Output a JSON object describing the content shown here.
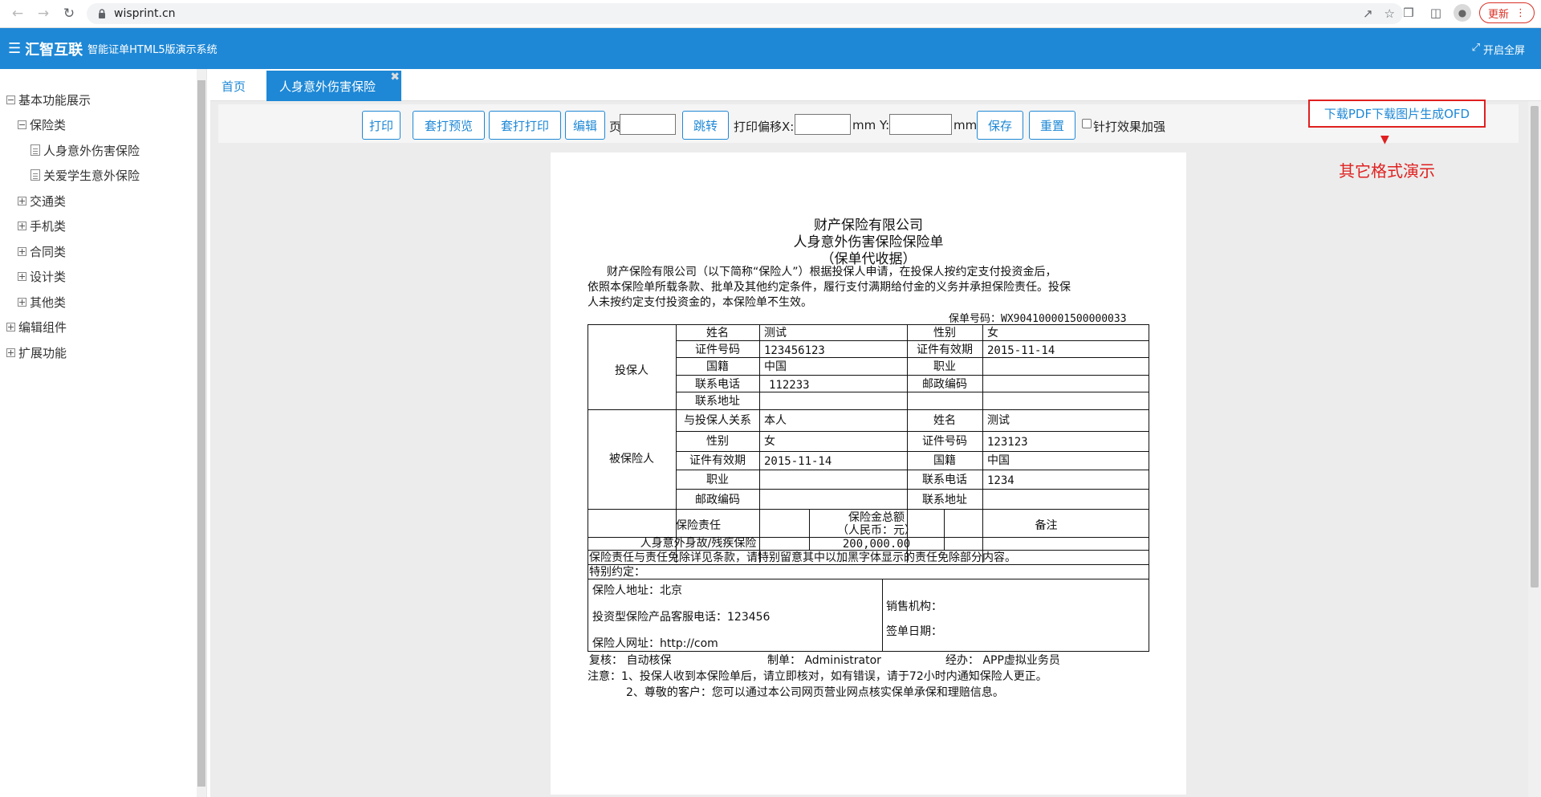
{
  "browser": {
    "url": "wisprint.cn",
    "update_label": "更新"
  },
  "header": {
    "brand": "汇智互联",
    "subtitle": "智能证单HTML5版演示系统",
    "fullscreen_label": "开启全屏"
  },
  "sidebar": {
    "items": [
      {
        "label": "基本功能展示"
      },
      {
        "label": "保险类"
      },
      {
        "label": "人身意外伤害保险"
      },
      {
        "label": "关爱学生意外保险"
      },
      {
        "label": "交通类"
      },
      {
        "label": "手机类"
      },
      {
        "label": "合同类"
      },
      {
        "label": "设计类"
      },
      {
        "label": "其他类"
      },
      {
        "label": "编辑组件"
      },
      {
        "label": "扩展功能"
      }
    ]
  },
  "tabs": {
    "home": "首页",
    "active": "人身意外伤害保险",
    "close": "✖"
  },
  "toolbar": {
    "print": "打印",
    "overlay_preview": "套打预览",
    "overlay_print": "套打打印",
    "edit": "编辑",
    "page_label": "页",
    "page_value": "",
    "jump": "跳转",
    "offset_x_label": "打印偏移X:",
    "offset_x_value": "",
    "mm_y_label": "mm Y:",
    "offset_y_value": "",
    "mm_label": "mm",
    "save": "保存",
    "reset": "重置",
    "needle_label": "针打效果加强"
  },
  "extra": {
    "box_text": "下载PDF下载图片生成OFD",
    "caption": "其它格式演示"
  },
  "document": {
    "company": "财产保险有限公司",
    "title": "人身意外伤害保险保险单",
    "subtitle": "（保单代收据）",
    "intro_1": "财产保险有限公司（以下简称“保险人”）根据投保人申请，在投保人按约定支付投资金后，",
    "intro_2": "依照本保险单所载条款、批单及其他约定条件，履行支付满期给付金的义务并承担保险责任。投保",
    "intro_3": "人未按约定支付投资金的，本保险单不生效。",
    "policy_no": "保单号码：WX904100001500000033",
    "applicant": {
      "section": "投保人",
      "name_label": "姓名",
      "name": "测试",
      "gender_label": "性别",
      "gender": "女",
      "id_label": "证件号码",
      "id": "123456123",
      "id_valid_label": "证件有效期",
      "id_valid": "2015-11-14",
      "nationality_label": "国籍",
      "nationality": "中国",
      "job_label": "职业",
      "job": "",
      "phone_label": "联系电话",
      "phone": "112233",
      "zip_label": "邮政编码",
      "zip": "",
      "address_label": "联系地址",
      "address": ""
    },
    "insured": {
      "section": "被保险人",
      "relation_label": "与投保人关系",
      "relation": "本人",
      "name_label": "姓名",
      "name": "测试",
      "gender_label": "性别",
      "gender": "女",
      "id_label": "证件号码",
      "id": "123123",
      "id_valid_label": "证件有效期",
      "id_valid": "2015-11-14",
      "nationality_label": "国籍",
      "nationality": "中国",
      "job_label": "职业",
      "job": "",
      "phone_label": "联系电话",
      "phone": "1234",
      "zip_label": "邮政编码",
      "zip": "",
      "address_label": "联系地址",
      "address": ""
    },
    "coverage": {
      "col_liability": "保险责任",
      "col_amount_1": "保险金总额",
      "col_amount_2": "（人民币：元）",
      "col_remark": "备注",
      "liability": "人身意外身故/残疾保险",
      "amount": "200,000.00",
      "remark": ""
    },
    "exclusion_note": "保险责任与责任免除详见条款，请特别留意其中以加黑字体显示的责任免除部分内容。",
    "special_terms": "特别约定：",
    "insurer_address": "保险人地址：北京",
    "service_phone": "投资型保险产品客服电话：123456",
    "insurer_website": "保险人网址：http://com",
    "sales_org": "销售机构：",
    "sign_date": "签单日期：",
    "review": "复核：  自动核保",
    "maker": "制单： Administrator",
    "handler": "经办：  APP虚拟业务员",
    "notice_1": "注意：1、投保人收到本保险单后，请立即核对，如有错误，请于72小时内通知保险人更正。",
    "notice_2": "2、尊敬的客户：您可以通过本公司网页营业网点核实保单承保和理赔信息。"
  },
  "colors": {
    "accent": "#1e88d6",
    "alert": "#e02020"
  }
}
